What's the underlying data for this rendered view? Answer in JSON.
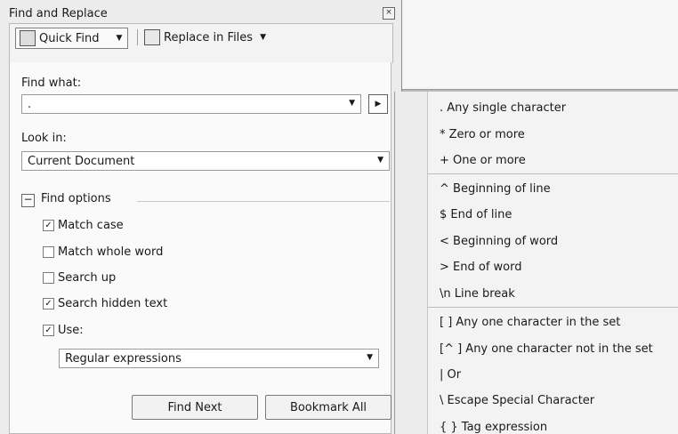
{
  "dialog": {
    "title": "Find and Replace",
    "close_icon": "close-icon",
    "toolbar": {
      "quick_find": "Quick Find",
      "replace_in_files": "Replace in Files"
    },
    "find_what_label": "Find what:",
    "find_value": ".",
    "look_in_label": "Look in:",
    "look_in_value": "Current Document",
    "find_options_label": "Find options",
    "options": [
      {
        "label": "Match case",
        "checked": true
      },
      {
        "label": "Match whole word",
        "checked": false
      },
      {
        "label": "Search up",
        "checked": false
      },
      {
        "label": "Search hidden text",
        "checked": true
      },
      {
        "label": "Use:",
        "checked": true
      }
    ],
    "use_value": "Regular expressions",
    "buttons": {
      "find_next": "Find Next",
      "bookmark_all": "Bookmark All"
    }
  },
  "menu": {
    "items": [
      ". Any single character",
      "* Zero or more",
      "+ One or more",
      "^ Beginning of line",
      "$ End of line",
      "< Beginning of word",
      "> End of word",
      "\\n Line break",
      "[ ] Any one character in the set",
      "[^ ] Any one character not in the set",
      "| Or",
      "\\ Escape Special Character",
      "{ } Tag expression"
    ]
  }
}
